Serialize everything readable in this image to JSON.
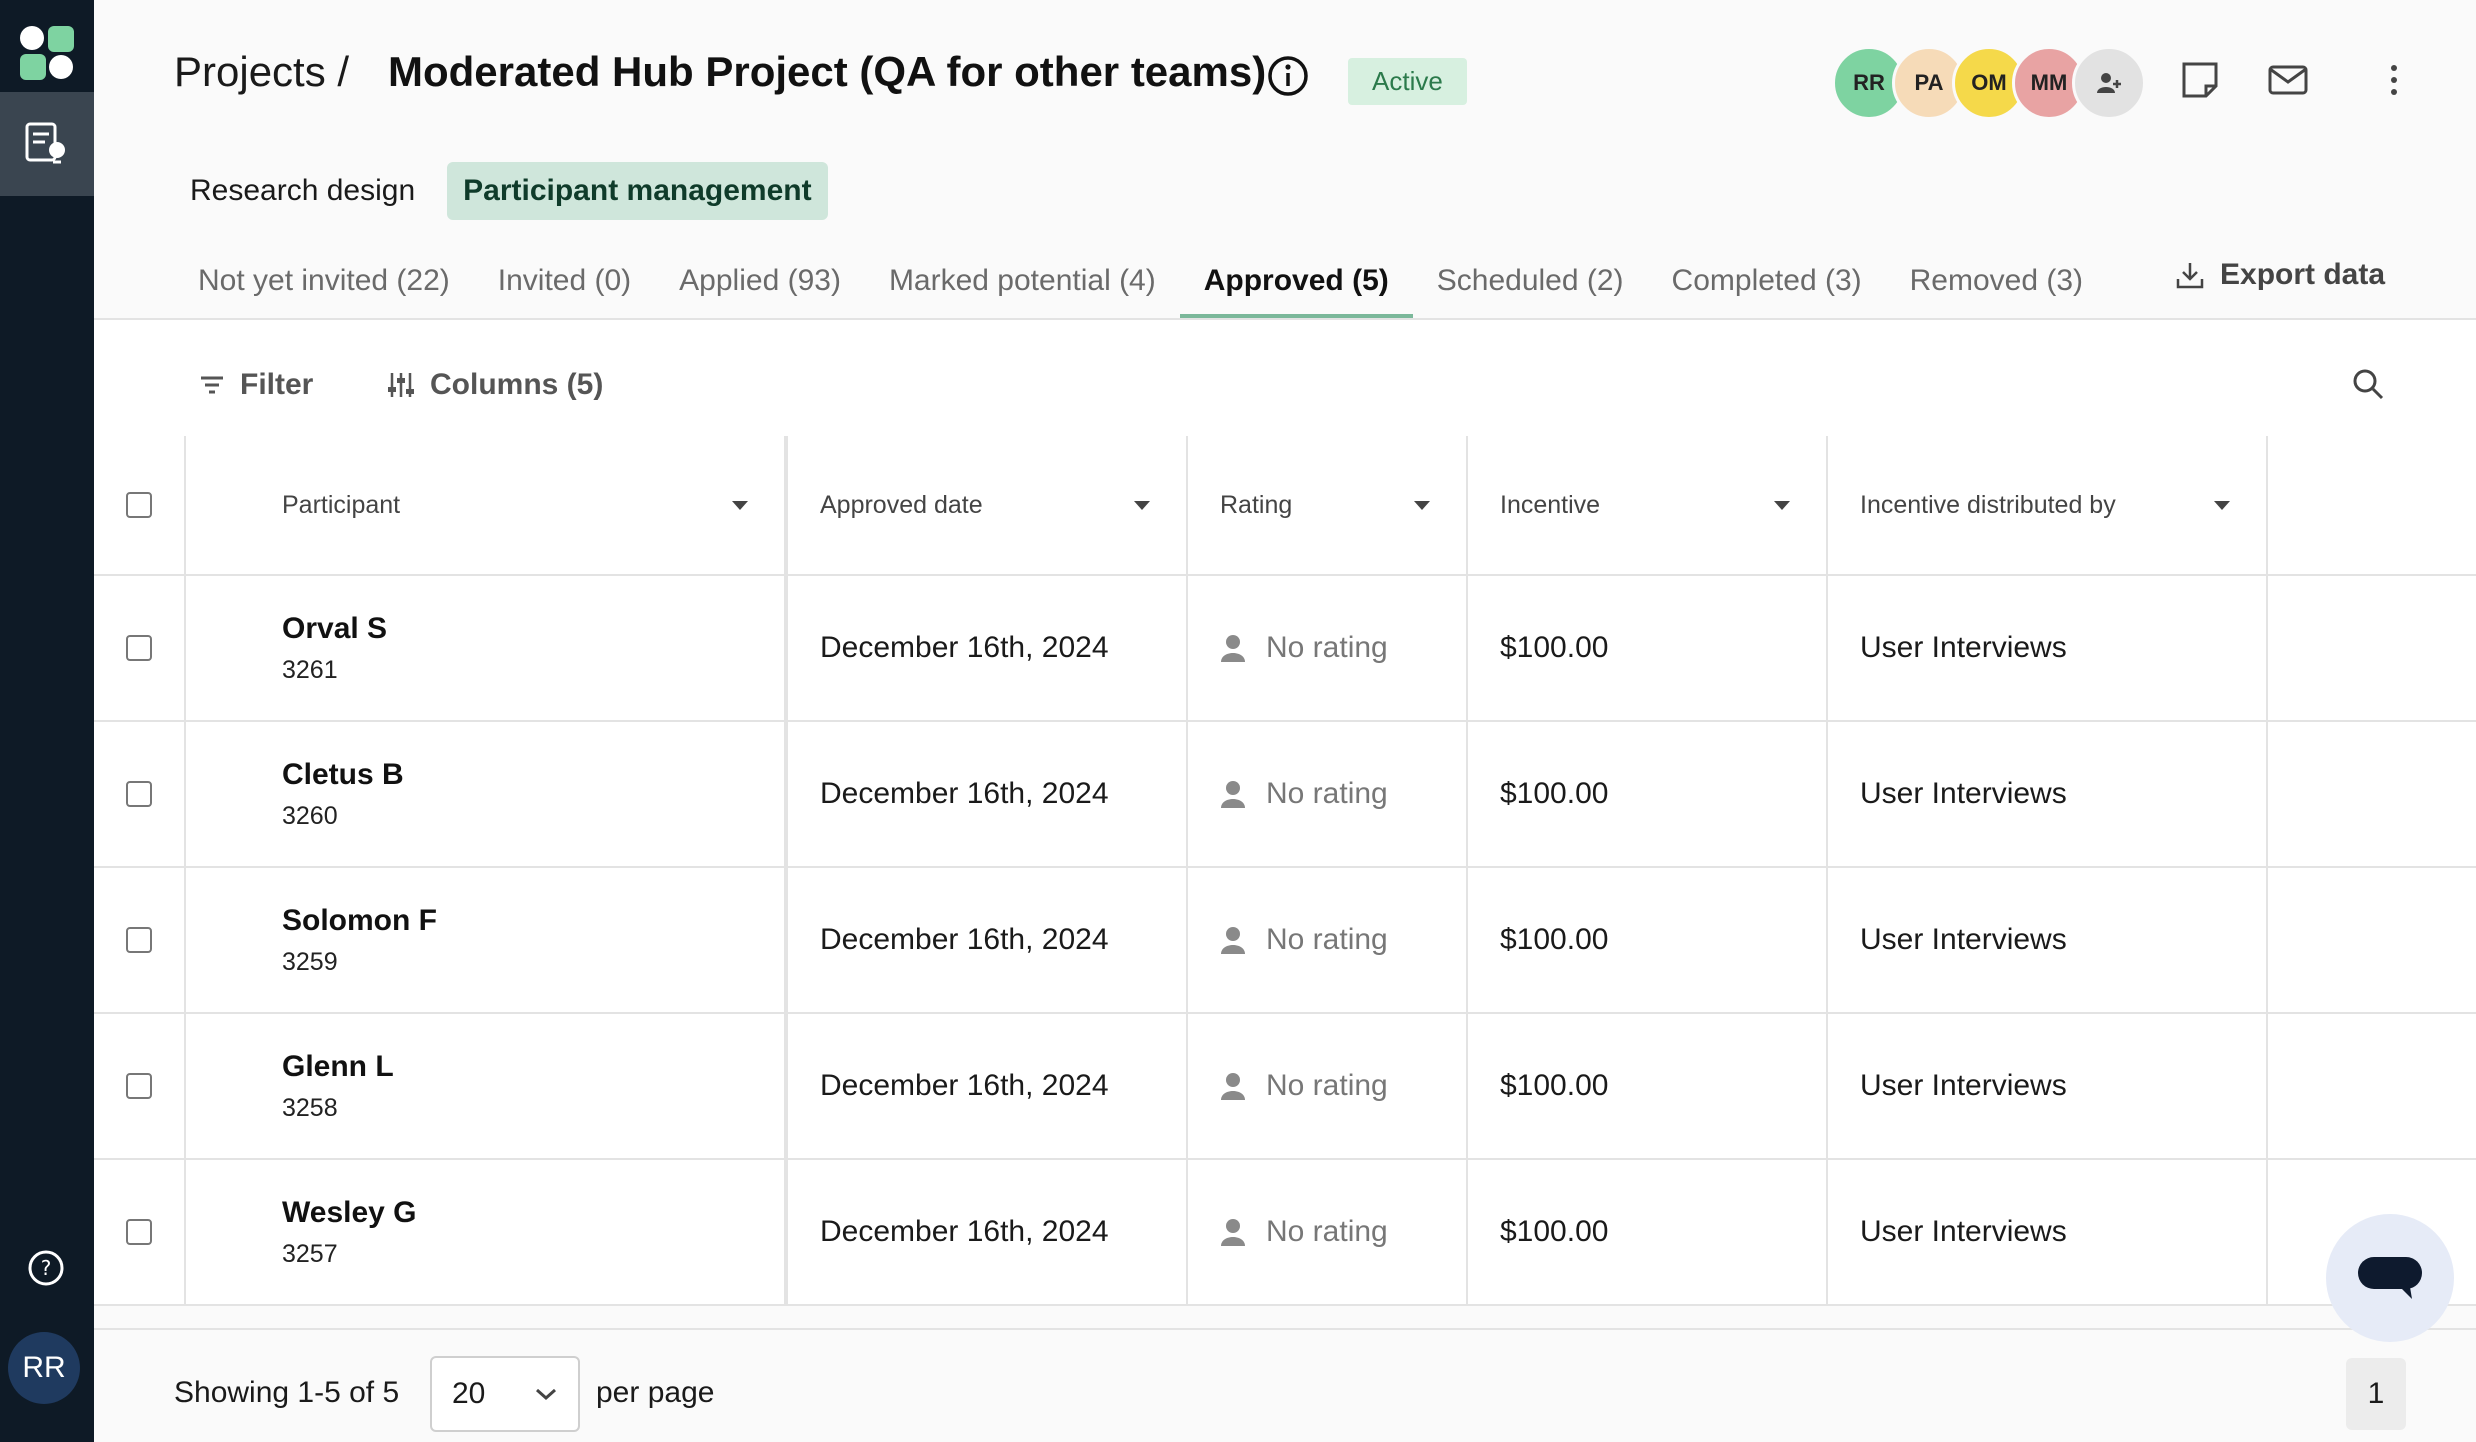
{
  "sidebar": {
    "icons": [
      "logo-icon",
      "participant-management-icon",
      "help-icon"
    ],
    "user_initials": "RR"
  },
  "header": {
    "breadcrumb": "Projects /",
    "title": "Moderated Hub Project (QA for other teams)",
    "status": "Active",
    "collaborators": [
      {
        "initials": "RR",
        "color": "#7ed3a1"
      },
      {
        "initials": "PA",
        "color": "#f6dbb8"
      },
      {
        "initials": "OM",
        "color": "#f5d94a"
      },
      {
        "initials": "MM",
        "color": "#e8a3a3"
      }
    ],
    "icons": [
      "add-collaborator-icon",
      "notes-icon",
      "mail-icon",
      "more-icon"
    ]
  },
  "subnav": {
    "items": [
      {
        "label": "Research design",
        "active": false
      },
      {
        "label": "Participant management",
        "active": true
      }
    ]
  },
  "tabs": [
    {
      "label": "Not yet invited (22)",
      "active": false
    },
    {
      "label": "Invited (0)",
      "active": false
    },
    {
      "label": "Applied (93)",
      "active": false
    },
    {
      "label": "Marked potential (4)",
      "active": false
    },
    {
      "label": "Approved (5)",
      "active": true
    },
    {
      "label": "Scheduled (2)",
      "active": false
    },
    {
      "label": "Completed (3)",
      "active": false
    },
    {
      "label": "Removed (3)",
      "active": false
    }
  ],
  "export_label": "Export data",
  "toolbar": {
    "filter_label": "Filter",
    "columns_label": "Columns (5)"
  },
  "table": {
    "headers": [
      "Participant",
      "Approved date",
      "Rating",
      "Incentive",
      "Incentive distributed by"
    ],
    "rows": [
      {
        "name": "Orval S",
        "id": "3261",
        "approved": "December 16th, 2024",
        "rating": "No rating",
        "incentive": "$100.00",
        "distributed_by": "User Interviews"
      },
      {
        "name": "Cletus B",
        "id": "3260",
        "approved": "December 16th, 2024",
        "rating": "No rating",
        "incentive": "$100.00",
        "distributed_by": "User Interviews"
      },
      {
        "name": "Solomon F",
        "id": "3259",
        "approved": "December 16th, 2024",
        "rating": "No rating",
        "incentive": "$100.00",
        "distributed_by": "User Interviews"
      },
      {
        "name": "Glenn L",
        "id": "3258",
        "approved": "December 16th, 2024",
        "rating": "No rating",
        "incentive": "$100.00",
        "distributed_by": "User Interviews"
      },
      {
        "name": "Wesley G",
        "id": "3257",
        "approved": "December 16th, 2024",
        "rating": "No rating",
        "incentive": "$100.00",
        "distributed_by": "User Interviews"
      }
    ]
  },
  "footer": {
    "showing": "Showing 1-5 of 5",
    "per_page_value": "20",
    "per_page_label": "per page",
    "current_page": "1"
  },
  "colors": {
    "sidebar_bg": "#0e1a26",
    "accent": "#7bb89a",
    "active_badge_bg": "#d7f0e0"
  }
}
